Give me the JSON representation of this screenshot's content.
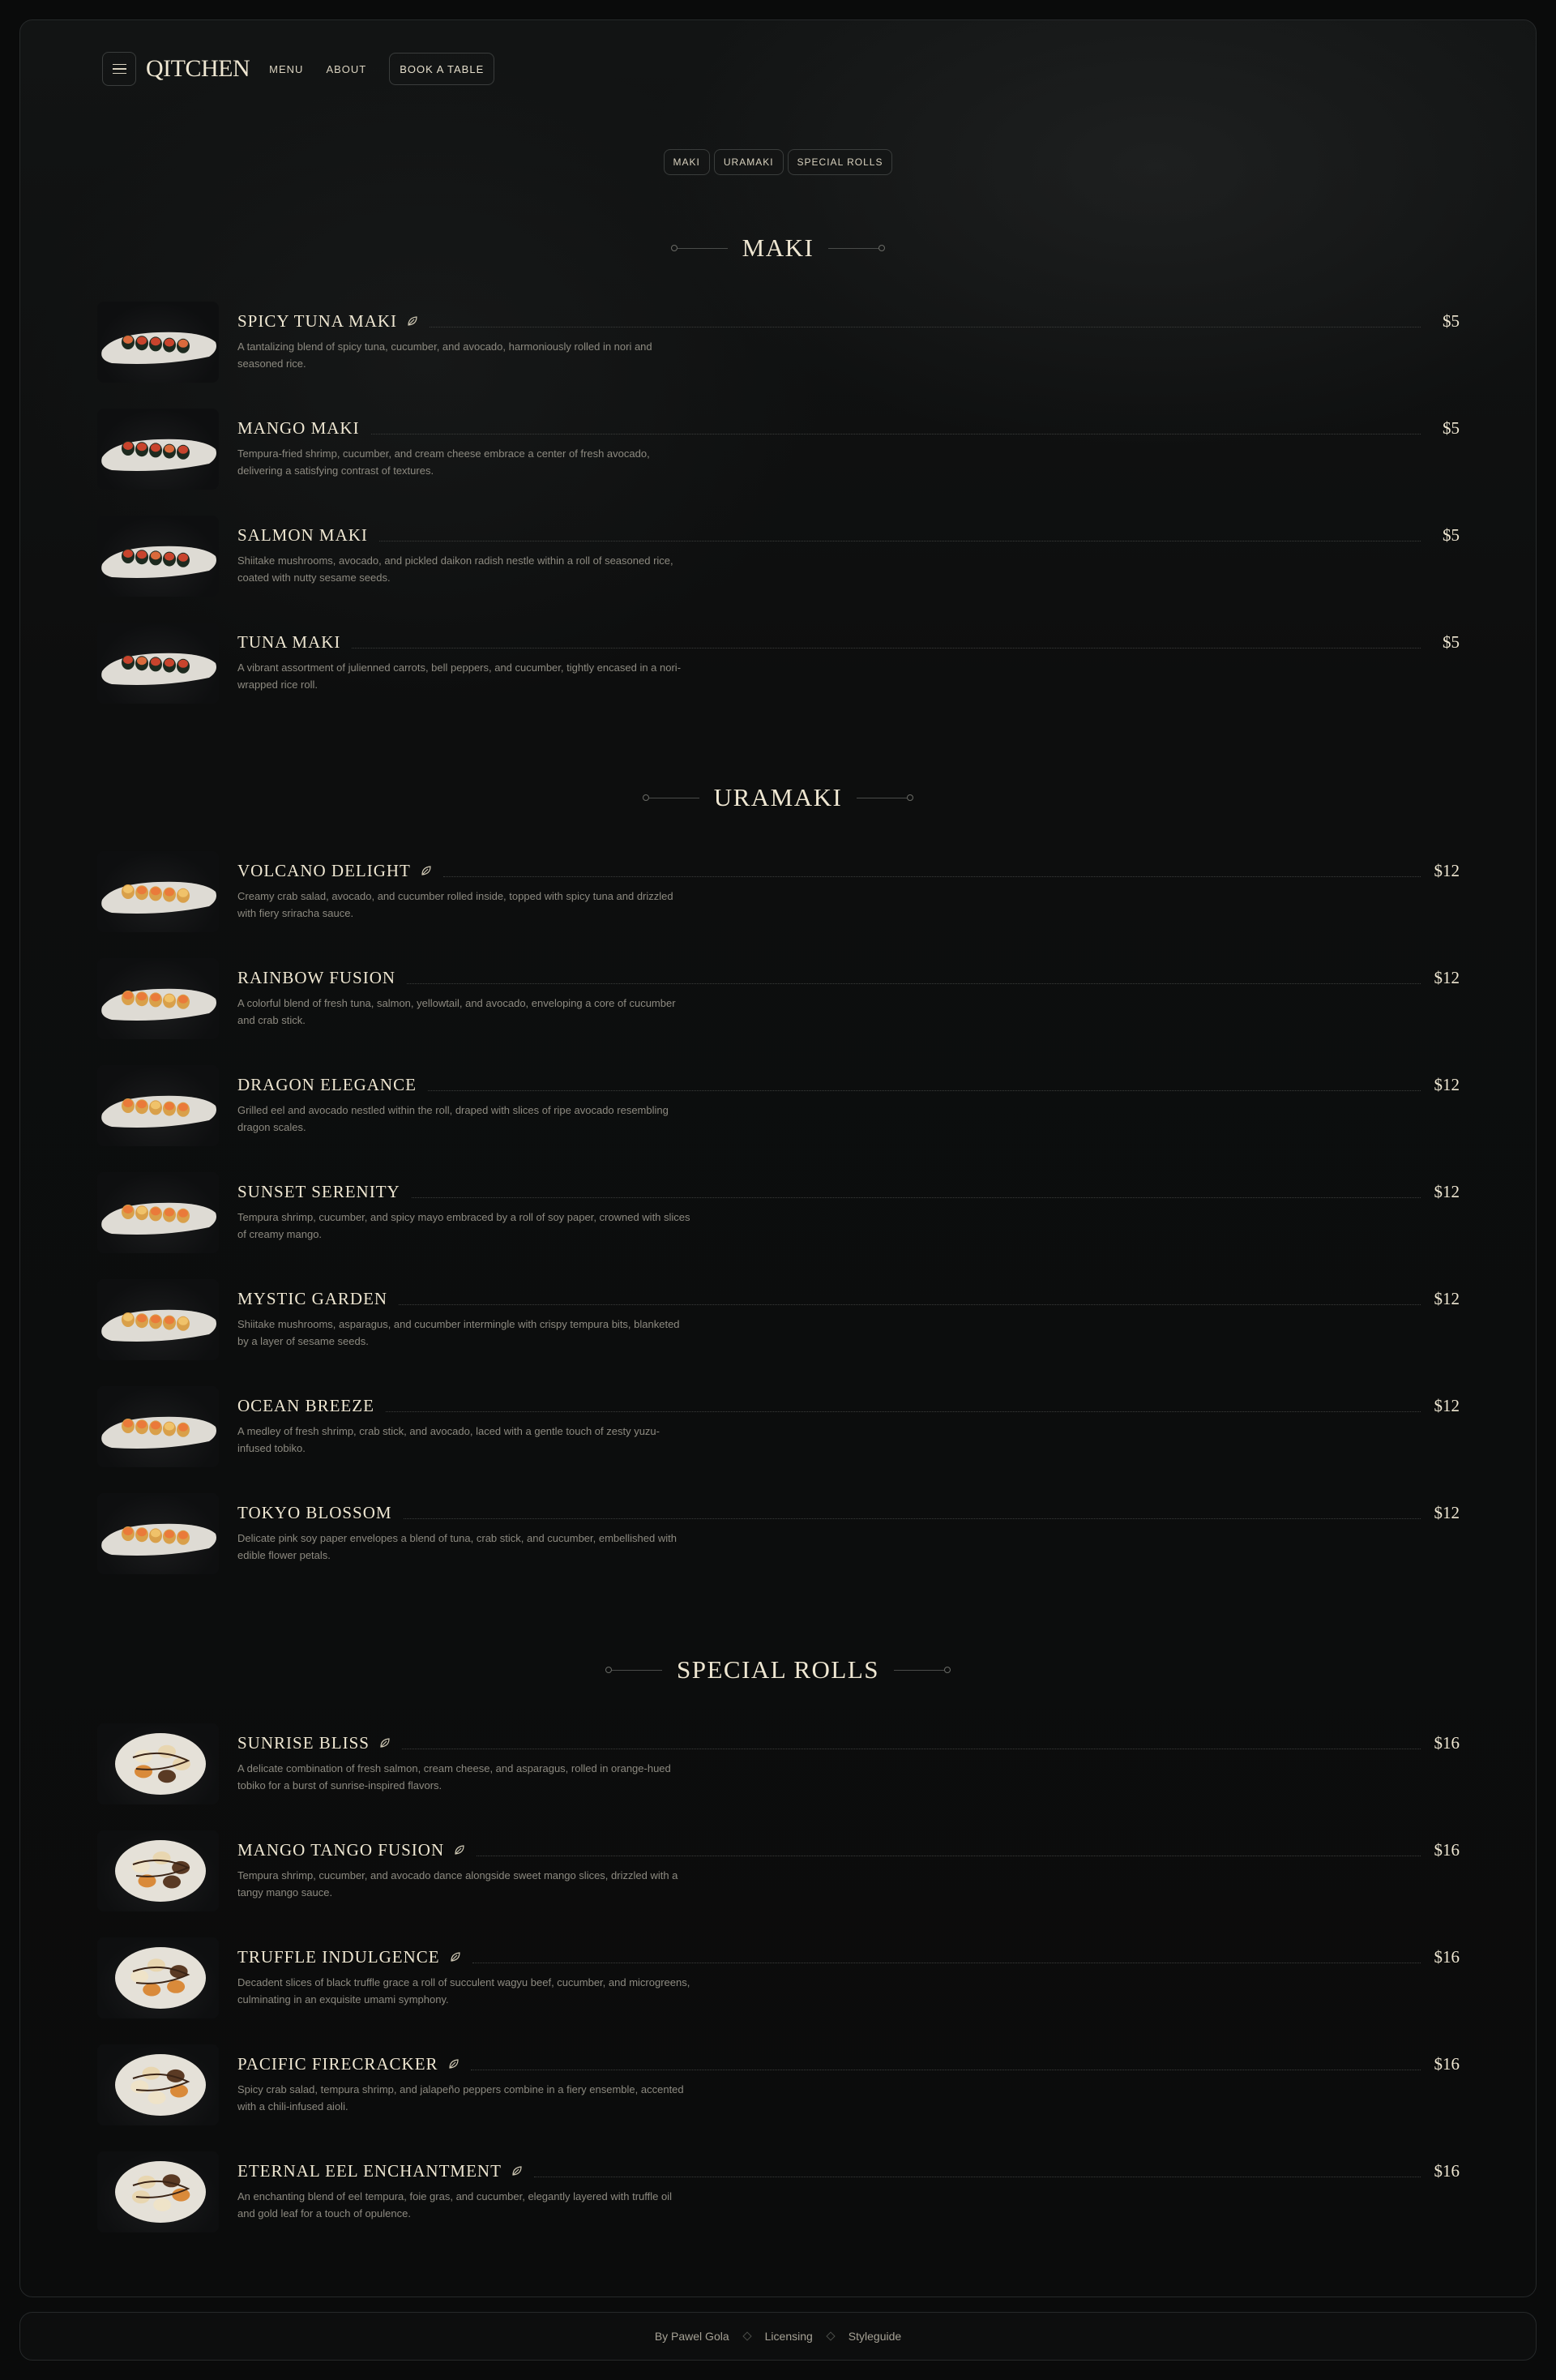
{
  "nav": {
    "logo": "QITCHEN",
    "links": [
      "MENU",
      "ABOUT"
    ],
    "book_label": "BOOK A TABLE"
  },
  "tabs": [
    "MAKI",
    "URAMAKI",
    "SPECIAL ROLLS"
  ],
  "sections": [
    {
      "title": "MAKI",
      "items": [
        {
          "name": "SPICY TUNA MAKI",
          "price": "$5",
          "vegan": true,
          "desc": "A tantalizing blend of spicy tuna, cucumber, and avocado, harmoniously rolled in nori and seasoned rice."
        },
        {
          "name": "MANGO MAKI",
          "price": "$5",
          "vegan": false,
          "desc": "Tempura-fried shrimp, cucumber, and cream cheese embrace a center of fresh avocado, delivering a satisfying contrast of textures."
        },
        {
          "name": "SALMON MAKI",
          "price": "$5",
          "vegan": false,
          "desc": "Shiitake mushrooms, avocado, and pickled daikon radish nestle within a roll of seasoned rice, coated with nutty sesame seeds."
        },
        {
          "name": "TUNA MAKI",
          "price": "$5",
          "vegan": false,
          "desc": "A vibrant assortment of julienned carrots, bell peppers, and cucumber, tightly encased in a nori-wrapped rice roll."
        }
      ]
    },
    {
      "title": "URAMAKI",
      "items": [
        {
          "name": "VOLCANO DELIGHT",
          "price": "$12",
          "vegan": true,
          "desc": "Creamy crab salad, avocado, and cucumber rolled inside, topped with spicy tuna and drizzled with fiery sriracha sauce."
        },
        {
          "name": "RAINBOW FUSION",
          "price": "$12",
          "vegan": false,
          "desc": "A colorful blend of fresh tuna, salmon, yellowtail, and avocado, enveloping a core of cucumber and crab stick."
        },
        {
          "name": "DRAGON ELEGANCE",
          "price": "$12",
          "vegan": false,
          "desc": "Grilled eel and avocado nestled within the roll, draped with slices of ripe avocado resembling dragon scales."
        },
        {
          "name": "SUNSET SERENITY",
          "price": "$12",
          "vegan": false,
          "desc": "Tempura shrimp, cucumber, and spicy mayo embraced by a roll of soy paper, crowned with slices of creamy mango."
        },
        {
          "name": "MYSTIC GARDEN",
          "price": "$12",
          "vegan": false,
          "desc": "Shiitake mushrooms, asparagus, and cucumber intermingle with crispy tempura bits, blanketed by a layer of sesame seeds."
        },
        {
          "name": "OCEAN BREEZE",
          "price": "$12",
          "vegan": false,
          "desc": "A medley of fresh shrimp, crab stick, and avocado, laced with a gentle touch of zesty yuzu-infused tobiko."
        },
        {
          "name": "TOKYO BLOSSOM",
          "price": "$12",
          "vegan": false,
          "desc": "Delicate pink soy paper envelopes a blend of tuna, crab stick, and cucumber, embellished with edible flower petals."
        }
      ]
    },
    {
      "title": "SPECIAL ROLLS",
      "items": [
        {
          "name": "SUNRISE BLISS",
          "price": "$16",
          "vegan": true,
          "desc": "A delicate combination of fresh salmon, cream cheese, and asparagus, rolled in orange-hued tobiko for a burst of sunrise-inspired flavors."
        },
        {
          "name": "MANGO TANGO FUSION",
          "price": "$16",
          "vegan": true,
          "desc": "Tempura shrimp, cucumber, and avocado dance alongside sweet mango slices, drizzled with a tangy mango sauce."
        },
        {
          "name": "TRUFFLE INDULGENCE",
          "price": "$16",
          "vegan": true,
          "desc": "Decadent slices of black truffle grace a roll of succulent wagyu beef, cucumber, and microgreens, culminating in an exquisite umami symphony."
        },
        {
          "name": "PACIFIC FIRECRACKER",
          "price": "$16",
          "vegan": true,
          "desc": "Spicy crab salad, tempura shrimp, and jalapeño peppers combine in a fiery ensemble, accented with a chili-infused aioli."
        },
        {
          "name": "ETERNAL EEL ENCHANTMENT",
          "price": "$16",
          "vegan": true,
          "desc": "An enchanting blend of eel tempura, foie gras, and cucumber, elegantly layered with truffle oil and gold leaf for a touch of opulence."
        }
      ]
    }
  ],
  "footer": {
    "credit": "By Pawel Gola",
    "links": [
      "Licensing",
      "Styleguide"
    ]
  },
  "colors": {
    "background": "#0a0b0b",
    "text": "#efe7d2",
    "muted": "#8d8a80",
    "border": "#3a3d3c"
  }
}
